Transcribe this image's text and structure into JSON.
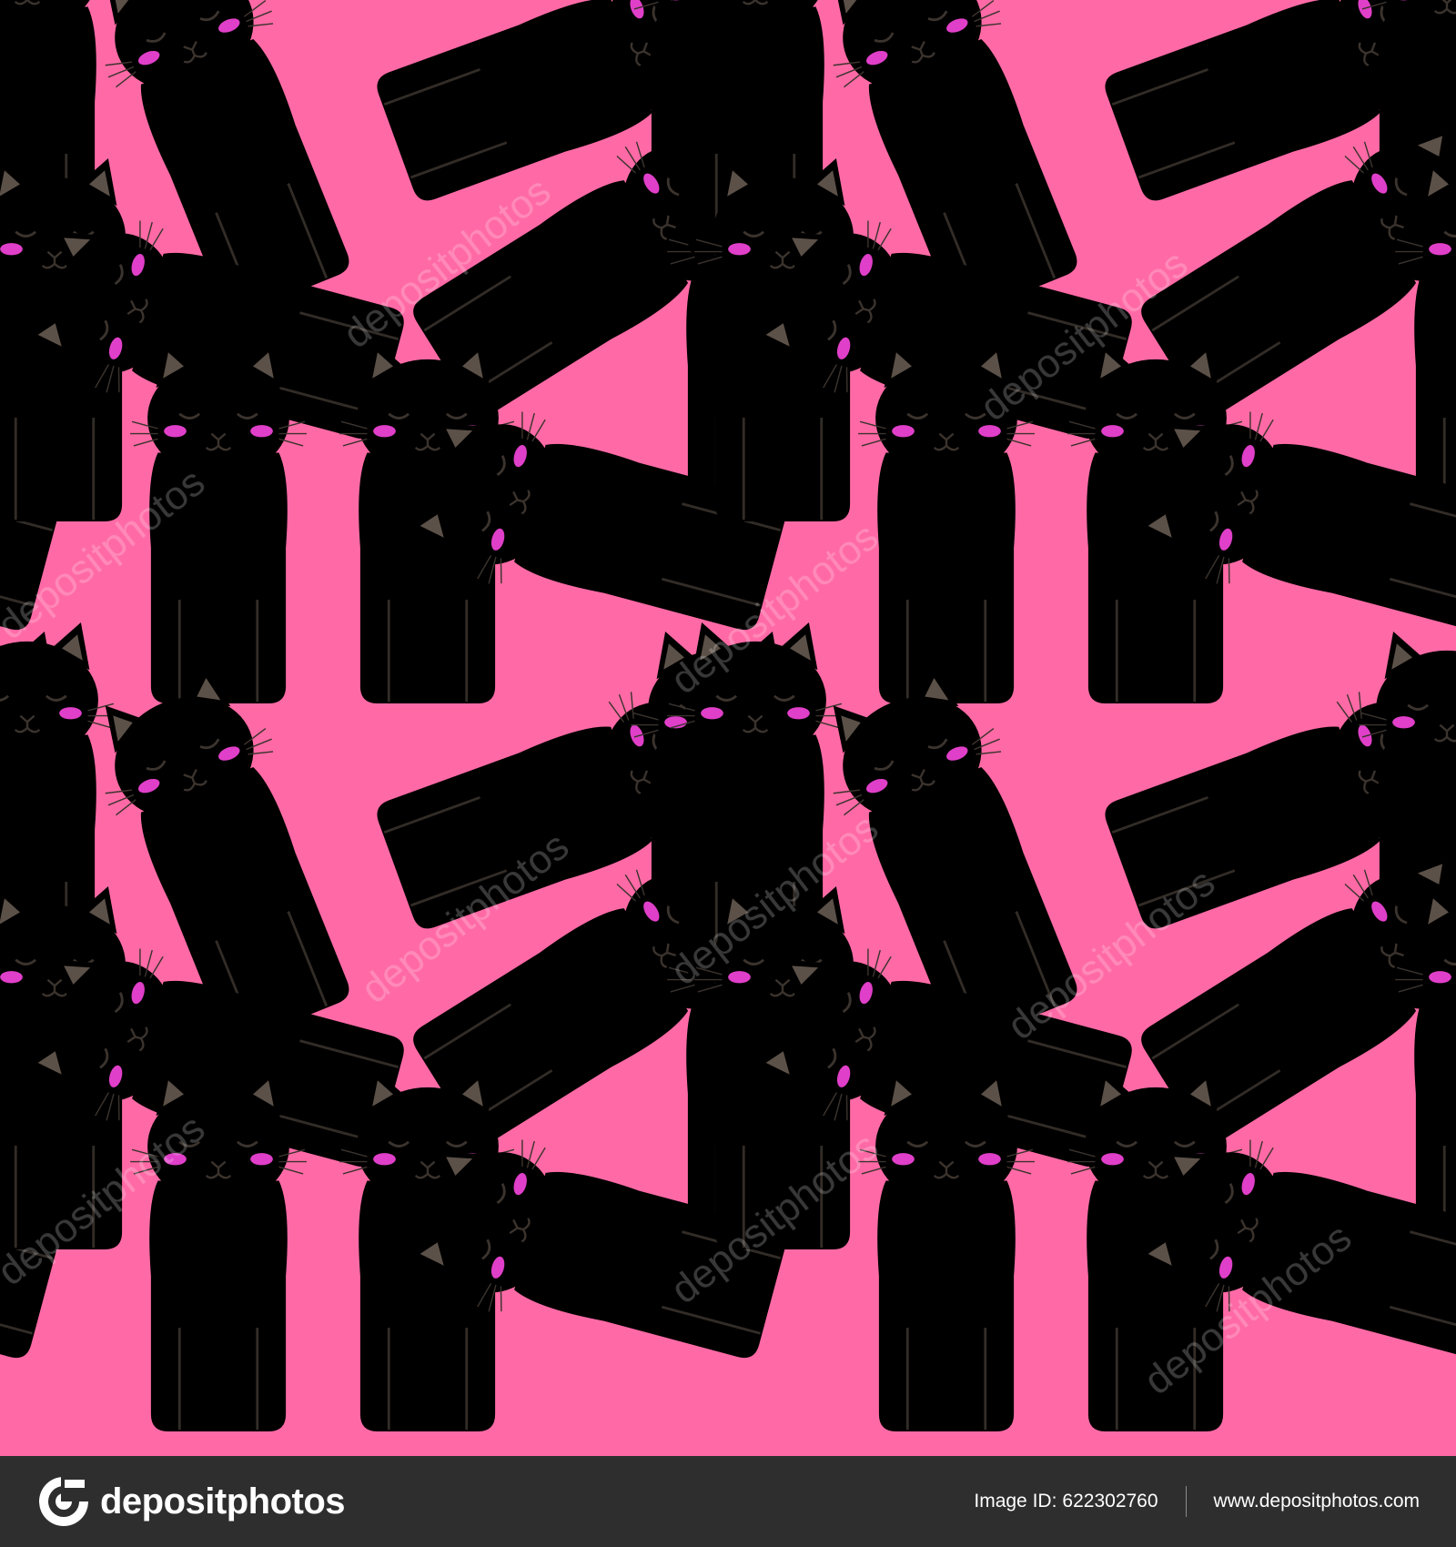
{
  "image": {
    "background_color": "#ff6aa6",
    "footer_color": "#2e2e2e",
    "subject": "seamless pattern of cartoon cats",
    "cat_colors": {
      "white": "#fbf3f1",
      "cream": "#f4ece6",
      "light_gray": "#cbbfb5",
      "gray_brown": "#7f7466",
      "tan": "#a5825b",
      "belly": "#fdeff3",
      "blush": "#e03fc9"
    }
  },
  "watermark": {
    "text": "depositphotos"
  },
  "footer": {
    "brand_name": "depositphotos",
    "image_id_label": "Image ID:",
    "image_id": "622302760",
    "site_url": "www.depositphotos.com"
  }
}
